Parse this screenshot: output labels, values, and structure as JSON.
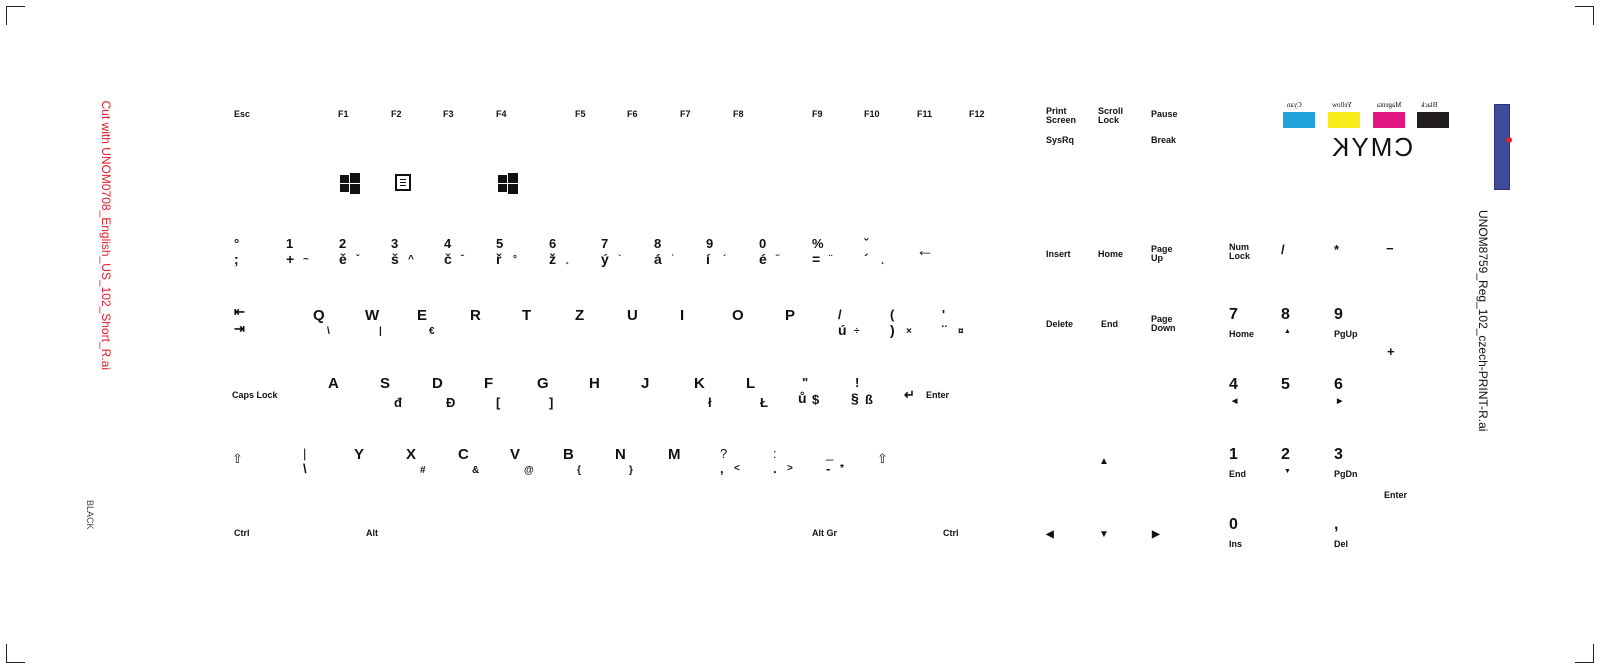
{
  "sheet": {
    "left_note": "Cut with UNOM0708_English_US_102_Short_R.ai",
    "right_note": "UNOM8759_Reg_102_czech-PRINT-R.ai",
    "plate_label": "BLACK",
    "cmyk_title": "CMYK",
    "swatches": [
      {
        "name": "Black",
        "color": "#231f20"
      },
      {
        "name": "Magenta",
        "color": "#e0157f"
      },
      {
        "name": "Yellow",
        "color": "#f7ec1c"
      },
      {
        "name": "Cyan",
        "color": "#22a3dc"
      }
    ]
  },
  "function_row": {
    "esc": "Esc",
    "keys": [
      "F1",
      "F2",
      "F3",
      "F4",
      "F5",
      "F6",
      "F7",
      "F8",
      "F9",
      "F10",
      "F11",
      "F12"
    ],
    "print_screen": "Print\nScreen",
    "print_screen_alt": "SysRq",
    "scroll_lock": "Scroll\nLock",
    "pause": "Pause",
    "pause_alt": "Break",
    "fn_icons": [
      "windows-icon",
      "menu-icon",
      "windows-icon"
    ]
  },
  "number_row": [
    {
      "top": "°",
      "bottom": ";",
      "alt": ""
    },
    {
      "top": "1",
      "bottom": "+",
      "alt": "~"
    },
    {
      "top": "2",
      "bottom": "ě",
      "alt": "ˇ"
    },
    {
      "top": "3",
      "bottom": "š",
      "alt": "^"
    },
    {
      "top": "4",
      "bottom": "č",
      "alt": "˘"
    },
    {
      "top": "5",
      "bottom": "ř",
      "alt": "°"
    },
    {
      "top": "6",
      "bottom": "ž",
      "alt": "˛"
    },
    {
      "top": "7",
      "bottom": "ý",
      "alt": "`"
    },
    {
      "top": "8",
      "bottom": "á",
      "alt": "˙"
    },
    {
      "top": "9",
      "bottom": "í",
      "alt": "´"
    },
    {
      "top": "0",
      "bottom": "é",
      "alt": "˝"
    },
    {
      "top": "%",
      "bottom": "=",
      "alt": "¨"
    },
    {
      "top": "ˇ",
      "bottom": "´",
      "alt": "¸"
    },
    {
      "top": "←",
      "bottom": "",
      "alt": ""
    }
  ],
  "qwerty_row": [
    {
      "top": "Q",
      "alt": "\\"
    },
    {
      "top": "W",
      "alt": "|"
    },
    {
      "top": "E",
      "alt": "€"
    },
    {
      "top": "R",
      "alt": ""
    },
    {
      "top": "T",
      "alt": ""
    },
    {
      "top": "Z",
      "alt": ""
    },
    {
      "top": "U",
      "alt": ""
    },
    {
      "top": "I",
      "alt": ""
    },
    {
      "top": "O",
      "alt": ""
    },
    {
      "top": "P",
      "alt": ""
    },
    {
      "top": "/",
      "bottom": "ú",
      "alt": "÷"
    },
    {
      "top": "(",
      "bottom": ")",
      "alt": "×"
    },
    {
      "top": "'",
      "bottom": "¨",
      "alt": "¤"
    }
  ],
  "home_row": {
    "caps": "Caps Lock",
    "keys": [
      {
        "top": "A",
        "alt": ""
      },
      {
        "top": "S",
        "alt": "đ"
      },
      {
        "top": "D",
        "alt": "Đ"
      },
      {
        "top": "F",
        "alt": "["
      },
      {
        "top": "G",
        "alt": "]"
      },
      {
        "top": "H",
        "alt": ""
      },
      {
        "top": "J",
        "alt": ""
      },
      {
        "top": "K",
        "alt": "ł"
      },
      {
        "top": "L",
        "alt": "Ł"
      },
      {
        "top": "\"",
        "bottom": "ů",
        "alt": "$"
      },
      {
        "top": "!",
        "bottom": "§",
        "alt": "ß"
      }
    ],
    "enter": "Enter"
  },
  "shift_row": {
    "keys": [
      {
        "top": "|",
        "bottom": "\\",
        "alt": ""
      },
      {
        "top": "Y",
        "alt": ""
      },
      {
        "top": "X",
        "alt": "#"
      },
      {
        "top": "C",
        "alt": "&"
      },
      {
        "top": "V",
        "alt": "@"
      },
      {
        "top": "B",
        "alt": "{"
      },
      {
        "top": "N",
        "alt": "}"
      },
      {
        "top": "M",
        "alt": ""
      },
      {
        "top": "?",
        "bottom": ",",
        "alt": "<"
      },
      {
        "top": ":",
        "bottom": ".",
        "alt": ">"
      },
      {
        "top": "_",
        "bottom": "-",
        "alt": "*"
      }
    ]
  },
  "bottom_row": {
    "ctrl_left": "Ctrl",
    "alt": "Alt",
    "alt_gr": "Alt Gr",
    "ctrl_right": "Ctrl"
  },
  "nav": {
    "insert": "Insert",
    "home": "Home",
    "page_up": "Page\nUp",
    "delete": "Delete",
    "end": "End",
    "page_down": "Page\nDown"
  },
  "numpad": {
    "num_lock": "Num\nLock",
    "divide": "/",
    "multiply": "*",
    "minus": "−",
    "plus": "+",
    "enter": "Enter",
    "keys": [
      {
        "top": "7",
        "bottom": "Home"
      },
      {
        "top": "8",
        "bottom": "▲"
      },
      {
        "top": "9",
        "bottom": "PgUp"
      },
      {
        "top": "4",
        "bottom": "◀"
      },
      {
        "top": "5",
        "bottom": ""
      },
      {
        "top": "6",
        "bottom": "▶"
      },
      {
        "top": "1",
        "bottom": "End"
      },
      {
        "top": "2",
        "bottom": "▼"
      },
      {
        "top": "3",
        "bottom": "PgDn"
      },
      {
        "top": "0",
        "bottom": "Ins"
      },
      {
        "top": ",",
        "bottom": "Del"
      }
    ]
  }
}
